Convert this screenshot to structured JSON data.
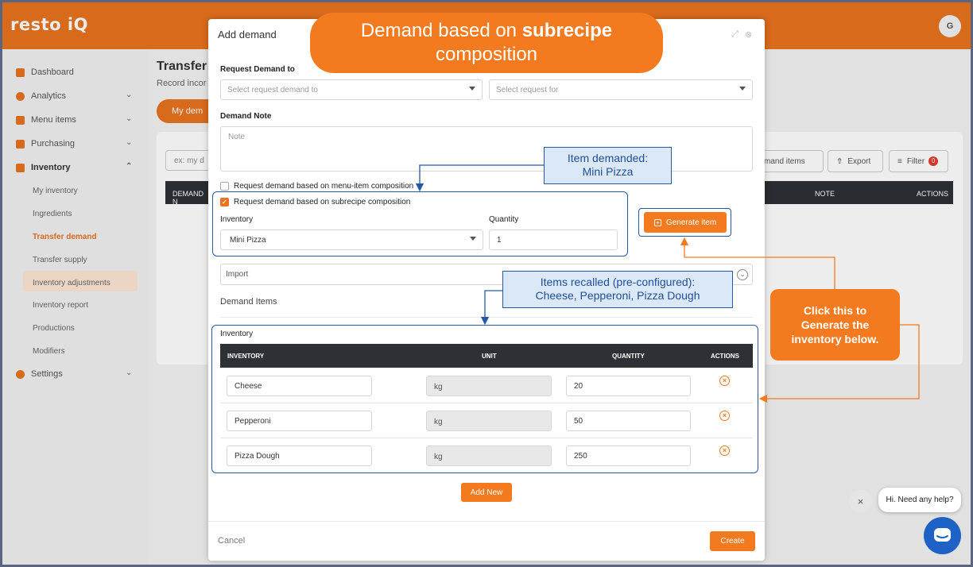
{
  "app": {
    "logo": "resto iQ",
    "user_initial": "G"
  },
  "sidebar": {
    "items": [
      {
        "label": "Dashboard"
      },
      {
        "label": "Analytics"
      },
      {
        "label": "Menu items"
      },
      {
        "label": "Purchasing"
      },
      {
        "label": "Inventory"
      },
      {
        "label": "Settings"
      }
    ],
    "inventory_sub": [
      "My inventory",
      "Ingredients",
      "Transfer demand",
      "Transfer supply",
      "Inventory adjustments",
      "Inventory report",
      "Productions",
      "Modifiers"
    ]
  },
  "background": {
    "title": "Transfer d",
    "subtitle": "Record incor",
    "my_demand": "My dem",
    "search_placeholder": "ex: my d",
    "demand_items_btn": "mand items",
    "export_btn": "Export",
    "filter_btn": "Filter",
    "filter_count": "0",
    "col_demand": "DEMAND N",
    "col_note": "NOTE",
    "col_actions": "ACTIONS"
  },
  "modal": {
    "title": "Add demand",
    "request_to_label": "Request Demand to",
    "request_to_placeholder": "Select request demand to",
    "request_for_placeholder": "Select request for",
    "note_label": "Demand Note",
    "note_placeholder": "Note",
    "cb_menu_item": "Request demand based on menu-item composition",
    "cb_subrecipe": "Request demand based on subrecipe composition",
    "inventory_label": "Inventory",
    "inventory_value": "Mini Pizza",
    "quantity_label": "Quantity",
    "quantity_value": "1",
    "generate_btn": "Generate item",
    "import_label": "Import",
    "demand_items_label": "Demand Items",
    "table_title": "Inventory",
    "columns": {
      "inventory": "INVENTORY",
      "unit": "UNIT",
      "quantity": "QUANTITY",
      "actions": "ACTIONS"
    },
    "rows": [
      {
        "inventory": "Cheese",
        "unit": "kg",
        "quantity": "20"
      },
      {
        "inventory": "Pepperoni",
        "unit": "kg",
        "quantity": "50"
      },
      {
        "inventory": "Pizza Dough",
        "unit": "kg",
        "quantity": "250"
      }
    ],
    "add_new_btn": "Add New",
    "cancel_btn": "Cancel",
    "create_btn": "Create"
  },
  "annotations": {
    "header_line1_pre": "Demand based on ",
    "header_line1_bold": "subrecipe",
    "header_line2": "composition",
    "item_demanded_line1": "Item demanded:",
    "item_demanded_line2": "Mini Pizza",
    "items_recalled_line1": "Items recalled (pre-configured):",
    "items_recalled_line2": "Cheese, Pepperoni, Pizza Dough",
    "click_line1": "Click this to",
    "click_line2": "Generate the",
    "click_line3": "inventory below."
  },
  "chat": {
    "message": "Hi. Need any help?"
  },
  "colors": {
    "brand": "#e9731f",
    "button": "#f47a1f",
    "annotation_blue": "#2459a8",
    "table_header": "#2d3034"
  }
}
